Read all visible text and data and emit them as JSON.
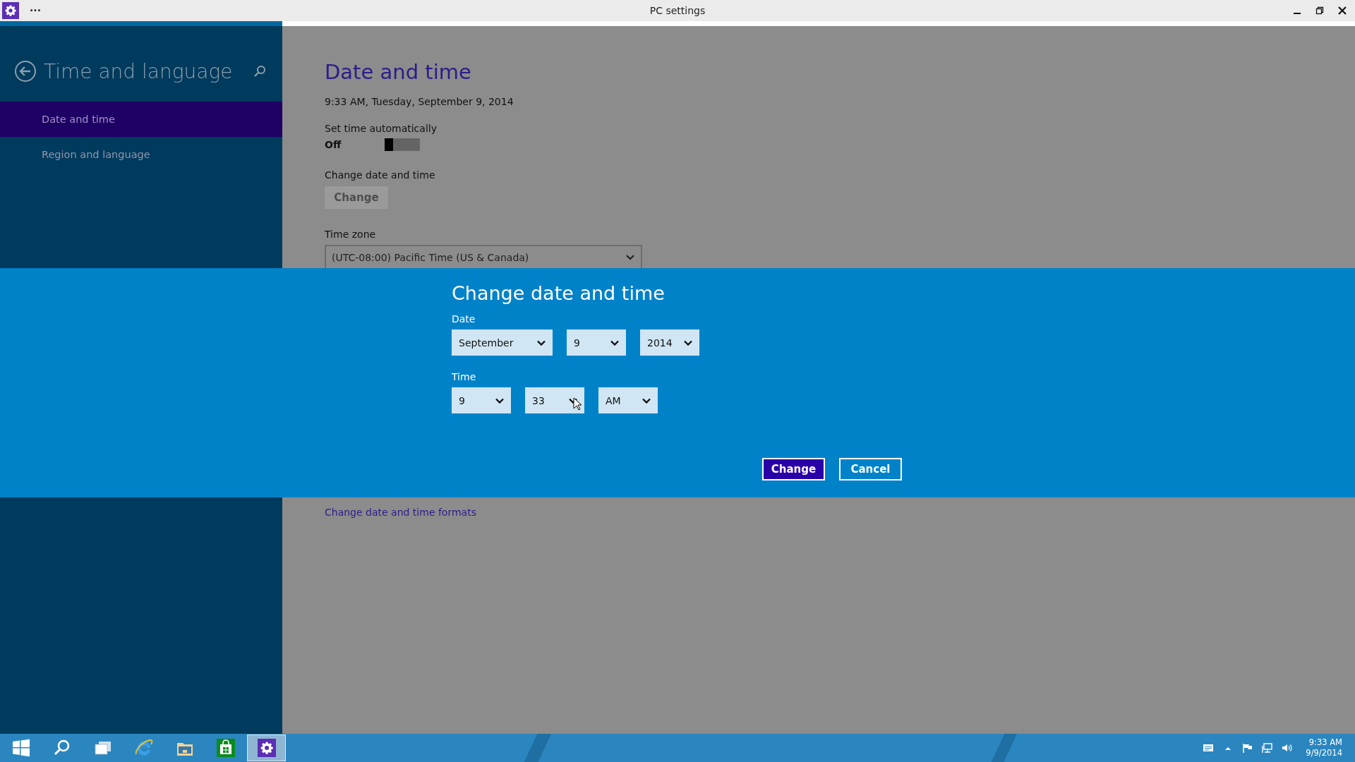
{
  "window": {
    "title": "PC settings",
    "menu_glyph": "···"
  },
  "sidebar": {
    "title": "Time and language",
    "items": [
      {
        "label": "Date and time",
        "selected": true
      },
      {
        "label": "Region and language",
        "selected": false
      }
    ]
  },
  "main": {
    "heading": "Date and time",
    "current_time": "9:33 AM, Tuesday, September 9, 2014",
    "auto_time": {
      "label": "Set time automatically",
      "state_text": "Off",
      "on": false
    },
    "change": {
      "label": "Change date and time",
      "button": "Change",
      "disabled": true
    },
    "time_zone": {
      "label": "Time zone",
      "value": "(UTC-08:00) Pacific Time (US & Canada)"
    },
    "formats_link": "Change date and time formats"
  },
  "dialog": {
    "title": "Change date and time",
    "groups": [
      {
        "label": "Date",
        "fields": [
          "September",
          "9",
          "2014"
        ]
      },
      {
        "label": "Time",
        "fields": [
          "9",
          "33",
          "AM"
        ]
      }
    ],
    "buttons": [
      {
        "label": "Change",
        "kind": "primary"
      },
      {
        "label": "Cancel",
        "kind": "secondary"
      }
    ]
  },
  "taskbar": {
    "apps": [
      {
        "kind": "start",
        "selected": false
      },
      {
        "kind": "search",
        "selected": false
      },
      {
        "kind": "task-view",
        "selected": false
      },
      {
        "kind": "browser",
        "selected": false
      },
      {
        "kind": "files",
        "selected": false
      },
      {
        "kind": "store",
        "selected": false
      },
      {
        "kind": "settings",
        "selected": true
      }
    ],
    "clock": {
      "time": "9:33 AM",
      "date": "9/9/2014"
    }
  }
}
